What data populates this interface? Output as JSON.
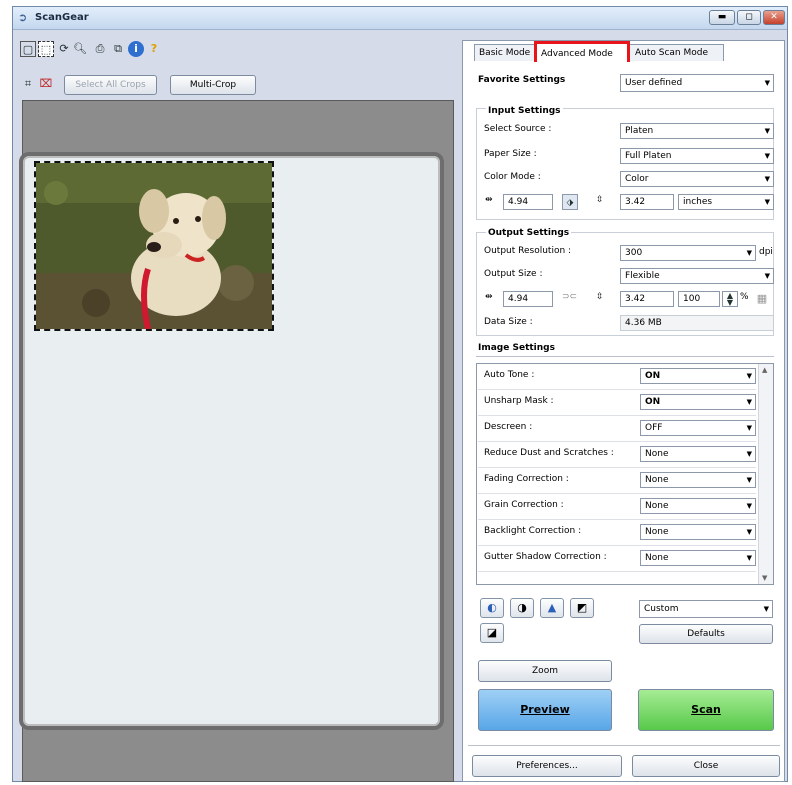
{
  "window": {
    "title": "ScanGear"
  },
  "toolbar": {
    "select_all_crops": "Select All Crops",
    "multi_crop": "Multi-Crop"
  },
  "tabs": [
    "Basic Mode",
    "Advanced Mode",
    "Auto Scan Mode"
  ],
  "favorite": {
    "label": "Favorite Settings",
    "value": "User defined"
  },
  "input_settings": {
    "header": "Input Settings",
    "select_source_label": "Select Source :",
    "select_source": "Platen",
    "paper_size_label": "Paper Size :",
    "paper_size": "Full Platen",
    "color_mode_label": "Color Mode :",
    "color_mode": "Color",
    "width": "4.94",
    "height": "3.42",
    "unit": "inches"
  },
  "output_settings": {
    "header": "Output Settings",
    "resolution_label": "Output Resolution :",
    "resolution": "300",
    "resolution_unit": "dpi",
    "size_label": "Output Size :",
    "size": "Flexible",
    "width": "4.94",
    "height": "3.42",
    "scale": "100",
    "scale_unit": "%",
    "data_size_label": "Data Size :",
    "data_size": "4.36 MB"
  },
  "image_settings": {
    "header": "Image Settings",
    "rows": [
      {
        "label": "Auto Tone :",
        "value": "ON"
      },
      {
        "label": "Unsharp Mask :",
        "value": "ON"
      },
      {
        "label": "Descreen :",
        "value": "OFF"
      },
      {
        "label": "Reduce Dust and Scratches :",
        "value": "None"
      },
      {
        "label": "Fading Correction :",
        "value": "None"
      },
      {
        "label": "Grain Correction :",
        "value": "None"
      },
      {
        "label": "Backlight Correction :",
        "value": "None"
      },
      {
        "label": "Gutter Shadow Correction :",
        "value": "None"
      }
    ]
  },
  "adjust": {
    "preset": "Custom",
    "defaults": "Defaults"
  },
  "buttons": {
    "zoom": "Zoom",
    "preview": "Preview",
    "scan": "Scan",
    "preferences": "Preferences...",
    "close": "Close"
  }
}
